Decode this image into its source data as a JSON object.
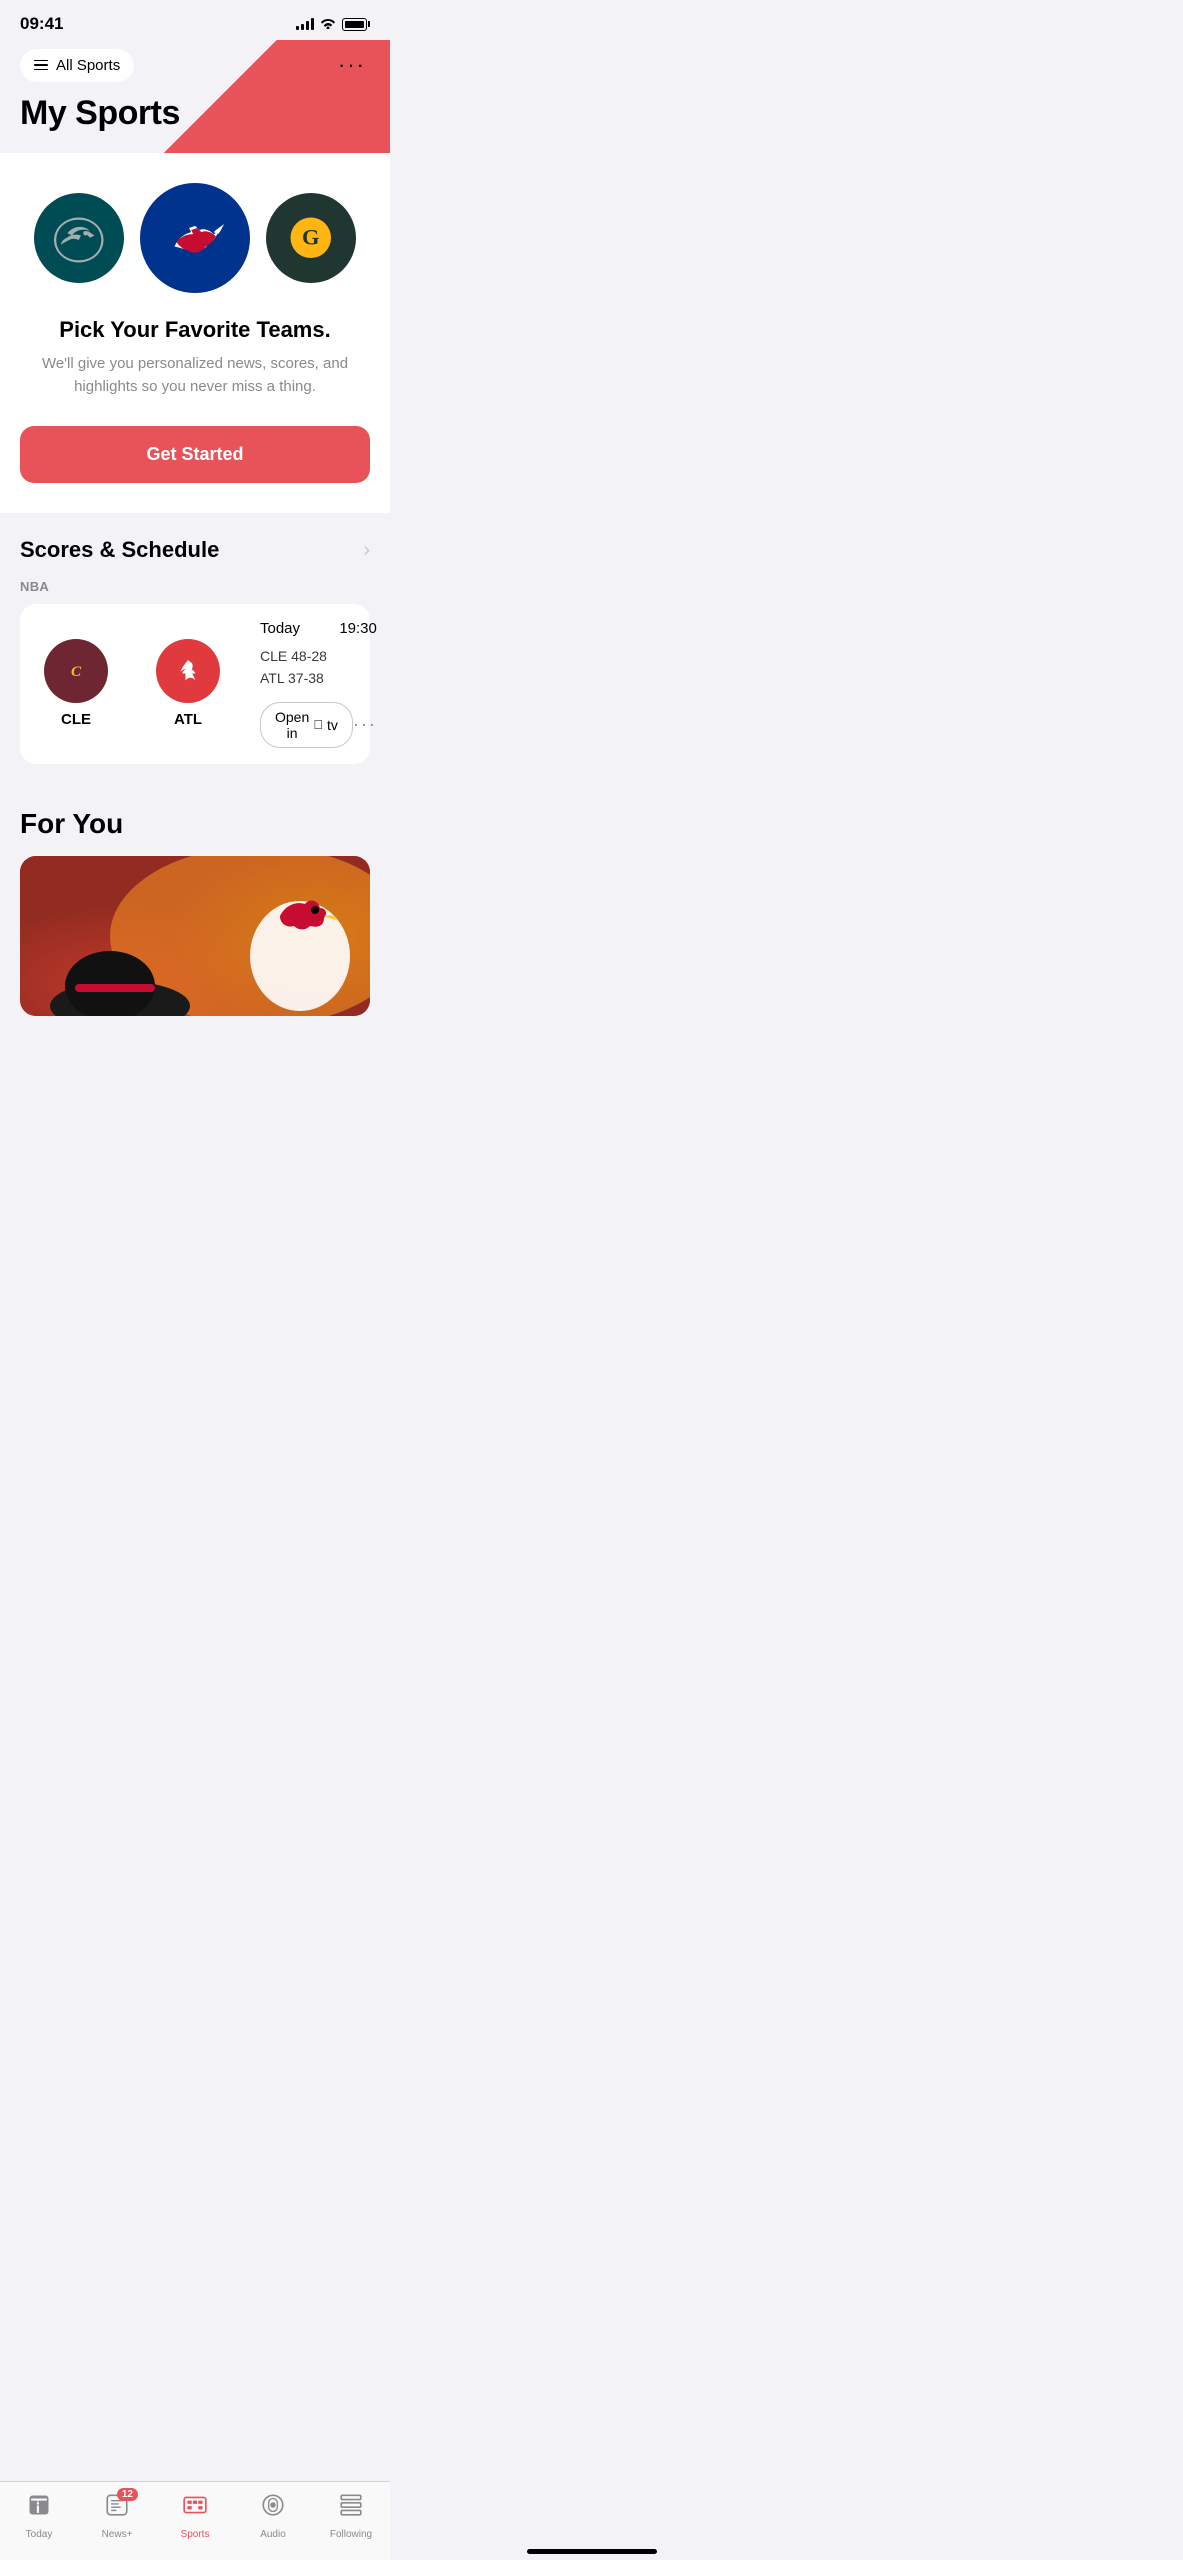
{
  "statusBar": {
    "time": "09:41"
  },
  "header": {
    "allSportsLabel": "All Sports",
    "moreLabel": "···",
    "pageTitle": "My Sports"
  },
  "teamsSection": {
    "teams": [
      {
        "name": "Eagles",
        "abbr": "PHI",
        "colorClass": "eagles"
      },
      {
        "name": "Bills",
        "abbr": "BUF",
        "colorClass": "bills"
      },
      {
        "name": "Packers",
        "abbr": "GB",
        "colorClass": "packers"
      }
    ],
    "pickTitle": "Pick Your Favorite Teams.",
    "pickSubtitle": "We'll give you personalized news, scores, and highlights so you never miss a thing.",
    "getStartedLabel": "Get Started"
  },
  "scoresSection": {
    "title": "Scores & Schedule",
    "leagueLabel": "NBA",
    "game": {
      "dayLabel": "Today",
      "timeLabel": "19:30",
      "team1Abbr": "CLE",
      "team1Record": "48-28",
      "team2Abbr": "ATL",
      "team2Record": "37-38",
      "openInTvLabel": "Open in  tv"
    }
  },
  "forYouSection": {
    "title": "For You"
  },
  "tabBar": {
    "tabs": [
      {
        "id": "today",
        "label": "Today",
        "active": false
      },
      {
        "id": "news",
        "label": "News+",
        "active": false,
        "badge": "12"
      },
      {
        "id": "sports",
        "label": "Sports",
        "active": true
      },
      {
        "id": "audio",
        "label": "Audio",
        "active": false
      },
      {
        "id": "following",
        "label": "Following",
        "active": false
      }
    ]
  },
  "colors": {
    "accent": "#e8535a",
    "tabActive": "#e8535a",
    "tabInactive": "#8a8a8e"
  }
}
